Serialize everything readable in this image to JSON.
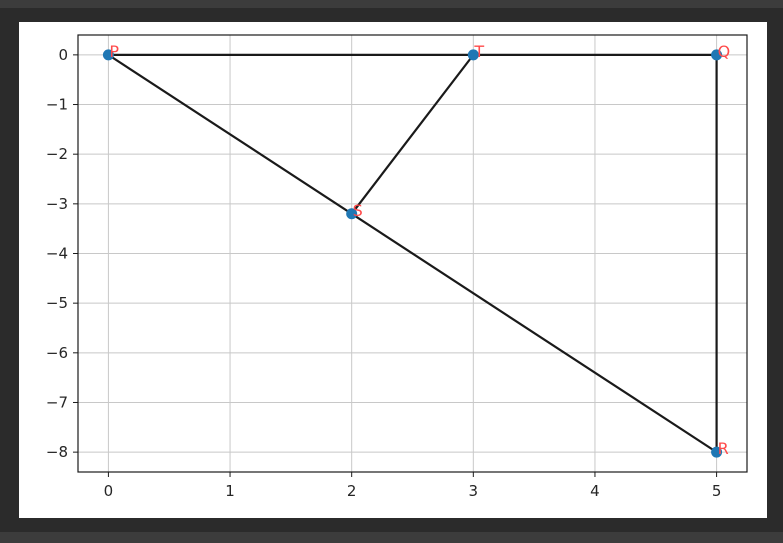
{
  "chart_data": {
    "type": "scatter",
    "title": "",
    "xlabel": "",
    "ylabel": "",
    "xlim": [
      -0.25,
      5.25
    ],
    "ylim": [
      -8.4,
      0.4
    ],
    "grid": true,
    "x_ticks": [
      0,
      1,
      2,
      3,
      4,
      5
    ],
    "y_ticks": [
      0,
      -1,
      -2,
      -3,
      -4,
      -5,
      -6,
      -7,
      -8
    ],
    "x_tick_labels": [
      "0",
      "1",
      "2",
      "3",
      "4",
      "5"
    ],
    "y_tick_labels": [
      "0",
      "−1",
      "−2",
      "−3",
      "−4",
      "−5",
      "−6",
      "−7",
      "−8"
    ],
    "points": [
      {
        "label": "P",
        "x": 0,
        "y": 0
      },
      {
        "label": "T",
        "x": 3,
        "y": 0
      },
      {
        "label": "Q",
        "x": 5,
        "y": 0
      },
      {
        "label": "S",
        "x": 2,
        "y": -3.2
      },
      {
        "label": "R",
        "x": 5,
        "y": -8
      }
    ],
    "segments": [
      [
        "P",
        "Q"
      ],
      [
        "Q",
        "R"
      ],
      [
        "P",
        "R"
      ],
      [
        "S",
        "T"
      ]
    ],
    "colors": {
      "marker": "#1f77b4",
      "line": "#1a1a1a",
      "label": "#ff4a4a",
      "grid": "#c8c8c8"
    }
  }
}
